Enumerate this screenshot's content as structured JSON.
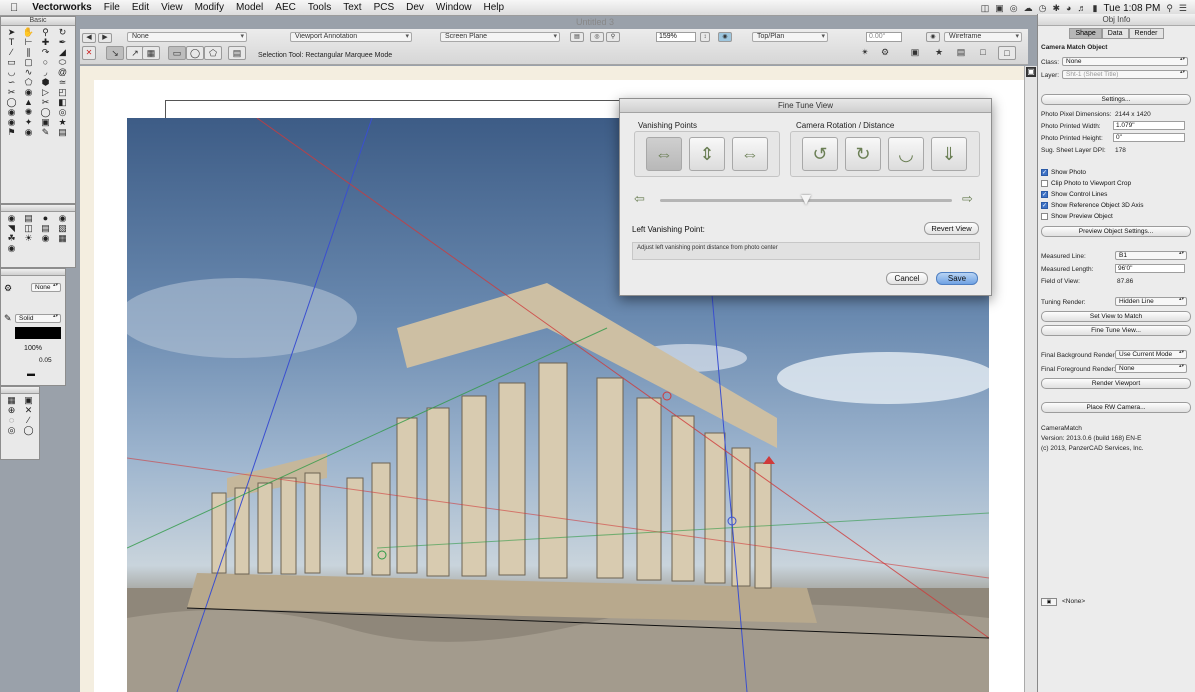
{
  "menubar": {
    "apple": "",
    "app": "Vectorworks",
    "items": [
      "File",
      "Edit",
      "View",
      "Modify",
      "Model",
      "AEC",
      "Tools",
      "Text",
      "PCS",
      "Dev",
      "Window",
      "Help"
    ],
    "clock": "Tue 1:08 PM"
  },
  "document_title": "Untitled 3",
  "toolbar": {
    "class_popup": "None",
    "layer_popup": "Viewport Annotation",
    "plane_popup": "Screen Plane",
    "zoom": "159%",
    "view_popup": "Top/Plan",
    "rotation": "0.00°",
    "render_popup": "Wireframe",
    "mode_text": "Selection Tool: Rectangular Marquee Mode"
  },
  "basic_palette": {
    "title": "Basic",
    "fill_label": "None",
    "pen_label": "Solid",
    "zoom_pct": "100%",
    "line_weight": "0.05"
  },
  "obj_info": {
    "title": "Obj Info",
    "tabs": [
      "Shape",
      "Data",
      "Render"
    ],
    "object_type": "Camera Match Object",
    "class_label": "Class:",
    "class_value": "None",
    "layer_label": "Layer:",
    "layer_value": "Sht-1 (Sheet Title)",
    "settings_button": "Settings...",
    "props": [
      {
        "label": "Photo Pixel Dimensions:",
        "value": "2144 x 1420"
      },
      {
        "label": "Photo Printed Width:",
        "value": "1.079\""
      },
      {
        "label": "Photo Printed Height:",
        "value": "0\""
      },
      {
        "label": "Sug. Sheet Layer DPI:",
        "value": "178"
      }
    ],
    "checks": [
      {
        "label": "Show Photo",
        "checked": true
      },
      {
        "label": "Clip Photo to Viewport Crop",
        "checked": false
      },
      {
        "label": "Show Control Lines",
        "checked": true
      },
      {
        "label": "Show Reference Object 3D Axis",
        "checked": true
      },
      {
        "label": "Show Preview Object",
        "checked": false
      }
    ],
    "preview_button": "Preview Object Settings...",
    "measured_line_label": "Measured Line:",
    "measured_line_value": "B1",
    "measured_length_label": "Measured Length:",
    "measured_length_value": "96'0\"",
    "fov_label": "Field of View:",
    "fov_value": "87.86",
    "tuning_label": "Tuning Render:",
    "tuning_value": "Hidden Line",
    "set_view_button": "Set View to Match",
    "fine_tune_button": "Fine Tune View...",
    "final_bg_label": "Final Background Render:",
    "final_bg_value": "Use Current Mode",
    "final_fg_label": "Final Foreground Render:",
    "final_fg_value": "None",
    "render_viewport_button": "Render Viewport",
    "place_camera_button": "Place RW Camera...",
    "about_name": "CameraMatch",
    "about_version": "Version: 2013.0.6 (build 168) EN-E",
    "about_copyright": "(c) 2013, PanzerCAD Services, Inc.",
    "footer": "<None>"
  },
  "dialog": {
    "title": "Fine Tune View",
    "group1": "Vanishing Points",
    "group2": "Camera Rotation / Distance",
    "slider_value": 0.5,
    "field_label": "Left Vanishing Point:",
    "revert_button": "Revert View",
    "help_text": "Adjust left vanishing point distance from photo center",
    "cancel_button": "Cancel",
    "save_button": "Save"
  }
}
